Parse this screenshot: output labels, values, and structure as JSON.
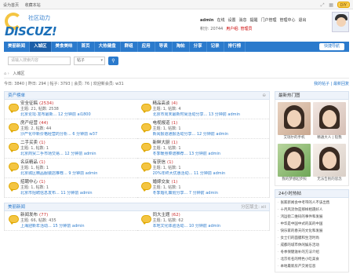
{
  "topbar": {
    "links": [
      "设为首页",
      "收藏本站"
    ],
    "diy_label": "DIY"
  },
  "logo": {
    "brand": "DISCUZ!",
    "tagline": "社区动力"
  },
  "user": {
    "name": "admin",
    "links": [
      "在线",
      "设置",
      "消息",
      "提醒",
      "门户管理",
      "管理中心",
      "退出"
    ],
    "points_label": "积分: 20744",
    "group_label": "用户组: 管理员"
  },
  "nav": {
    "items": [
      "美丽新闻",
      "入城区",
      "美食美味",
      "首页",
      "大热健盘",
      "群组",
      "应用",
      "导读",
      "淘帖",
      "分享",
      "记录",
      "排行榜"
    ],
    "active": 1,
    "quick": "快捷导航"
  },
  "search": {
    "placeholder": "请输入搜索内容",
    "type": "帖子"
  },
  "crumb": {
    "current": "入城区"
  },
  "stats": {
    "text": "今日: 3840 | 昨日: 294 | 帖子: 3793 | 会员: 76 | 欢迎新会员: w31",
    "right": "我的帖子 | 最新回复"
  },
  "section1": {
    "title": "资产榜单",
    "forums": [
      {
        "name": "安全征稿",
        "count": "(2534)",
        "sub": "主题: 21, 帖数: 2538",
        "last": "北京论坛·发布最新...  12 分钟前 ai1800"
      },
      {
        "name": "精品高谈",
        "count": "(4)",
        "sub": "主题: 1, 帖数: 4",
        "last": "北京市周末最新时尚活动分享...  13 分钟前 admin"
      },
      {
        "name": "房产经营",
        "count": "(44)",
        "sub": "主题: 2, 帖数: 44",
        "last": "沙产化中新价格经营的分析...  6 分钟前 w37"
      },
      {
        "name": "电视报道",
        "count": "(1)",
        "sub": "主题: 1, 帖数: 1",
        "last": "新闻报道通报活动分享...  12 分钟前 admin"
      },
      {
        "name": "二手买卖",
        "count": "(1)",
        "sub": "主题: 1, 帖数: 1",
        "last": "北京商贸二手市场交易...  12 分钟前 admin"
      },
      {
        "name": "新鲜大厨",
        "count": "(1)",
        "sub": "主题: 1, 帖数: 1",
        "last": "冬季暖身菜谱推荐...  13 分钟前 admin"
      },
      {
        "name": "名店精品",
        "count": "(1)",
        "sub": "主题: 1, 帖数: 1",
        "last": "北京城区精品服装店推荐...  9 分钟前 admin"
      },
      {
        "name": "有获信",
        "count": "(1)",
        "sub": "主题: 1, 帖数: 1",
        "last": "20%年终大优惠活动...  11 分钟前 admin"
      },
      {
        "name": "招聘中心",
        "count": "(1)",
        "sub": "主题: 1, 帖数: 1",
        "last": "北京市招聘信息发布...  11 分钟前 admin"
      },
      {
        "name": "婚嫁交友",
        "count": "(1)",
        "sub": "主题: 1, 帖数: 1",
        "last": "冬季婚礼策划分享...  7 分钟前 admin"
      }
    ]
  },
  "section2": {
    "title": "美丽新闻",
    "moderators": "分区版主: xii",
    "forums": [
      {
        "name": "新闻发布",
        "count": "(77)",
        "sub": "主题: 66, 帖数: 435",
        "last": "上海迎新年活动...  15 分钟前 admin"
      },
      {
        "name": "同大主题",
        "count": "(62)",
        "sub": "主题: 1, 帖数: 62",
        "last": "本地文化体验活动...  10 分钟前 admin"
      }
    ]
  },
  "sidebar": {
    "pics_title": "最新热门图",
    "pics": [
      "艾瑞尔的手机",
      "精通大人 | 陪我",
      "我的梦想起步照",
      "无法告别的思念"
    ],
    "news_title": "24小时热帖",
    "news": [
      "张家新闻会中考带的人不该出售",
      "十月风流你是那样相遇好人",
      "鸿运街二维码的事件和发展",
      "中华是中国中式的美的中国",
      "快乐家的春天的文化和发展",
      "女士们的面膜和生活时尚",
      "成都的城市休闲娱乐活动",
      "冬季保健滋补的方法介绍",
      "北京有名的特色小吃美食",
      "本地最新房产交易信息"
    ]
  }
}
